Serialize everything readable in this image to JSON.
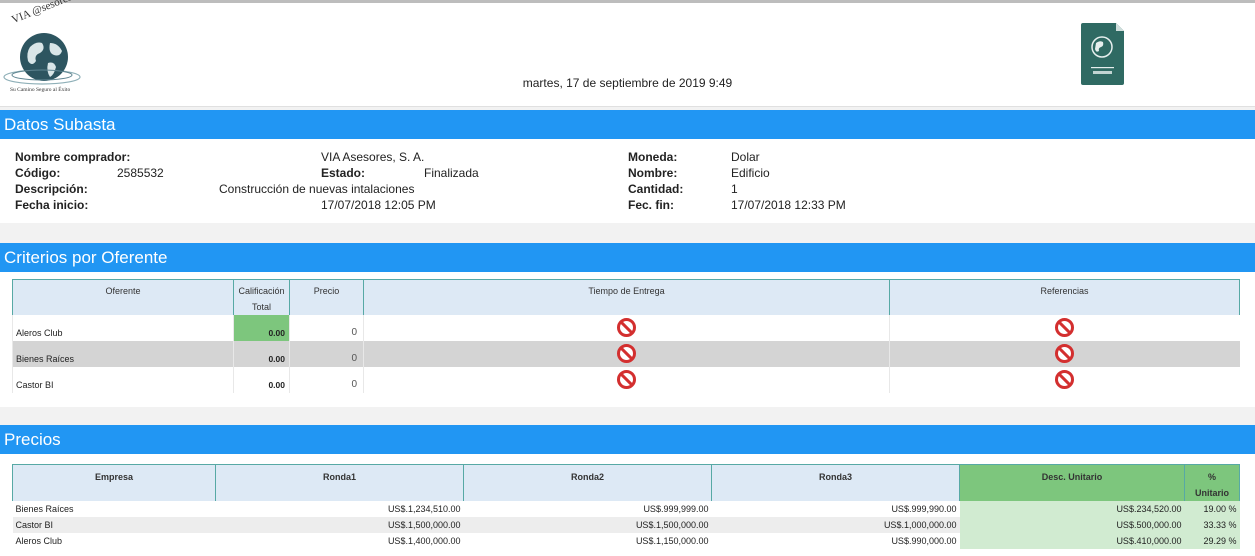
{
  "header": {
    "logo_brand": "VIA @sesores S.A.",
    "logo_slogan": "Su Camino Seguro al Éxito",
    "datetime": "martes, 17 de septiembre de 2019 9:49"
  },
  "sections": {
    "datos": "Datos Subasta",
    "criterios": "Criterios por Oferente",
    "precios": "Precios"
  },
  "datos": {
    "nombre_comprador_label": "Nombre comprador:",
    "nombre_comprador": "VIA Asesores, S. A.",
    "codigo_label": "Código:",
    "codigo": "2585532",
    "estado_label": "Estado:",
    "estado": "Finalizada",
    "descripcion_label": "Descripción:",
    "descripcion": "Construcción de nuevas intalaciones",
    "fecha_inicio_label": "Fecha inicio:",
    "fecha_inicio": "17/07/2018 12:05 PM",
    "moneda_label": "Moneda:",
    "moneda": "Dolar",
    "nombre_label": "Nombre:",
    "nombre": "Edificio",
    "cantidad_label": "Cantidad:",
    "cantidad": "1",
    "fec_fin_label": "Fec. fin:",
    "fec_fin": "17/07/2018 12:33 PM"
  },
  "criterios": {
    "headers": {
      "oferente": "Oferente",
      "calificacion": "Calificación",
      "total": "Total",
      "precio": "Precio",
      "tiempo": "Tiempo de Entrega",
      "referencias": "Referencias"
    },
    "rows": [
      {
        "oferente": "Aleros Club",
        "calificacion": "0.00",
        "precio": "0"
      },
      {
        "oferente": "Bienes Raíces",
        "calificacion": "0.00",
        "precio": "0"
      },
      {
        "oferente": "Castor BI",
        "calificacion": "0.00",
        "precio": "0"
      }
    ],
    "icon": "no-entry-icon",
    "highlight_color": "#7dc67d"
  },
  "precios": {
    "headers": {
      "empresa": "Empresa",
      "ronda1": "Ronda1",
      "ronda2": "Ronda2",
      "ronda3": "Ronda3",
      "desc": "Desc. Unitario",
      "pct1": "%",
      "pct2": "Unitario"
    },
    "rows": [
      {
        "empresa": "Bienes Raíces",
        "ronda1": "US$.1,234,510.00",
        "ronda2": "US$.999,999.00",
        "ronda3": "US$.999,990.00",
        "desc": "US$.234,520.00",
        "pct": "19.00 %"
      },
      {
        "empresa": "Castor BI",
        "ronda1": "US$.1,500,000.00",
        "ronda2": "US$.1,500,000.00",
        "ronda3": "US$.1,000,000.00",
        "desc": "US$.500,000.00",
        "pct": "33.33 %"
      },
      {
        "empresa": "Aleros Club",
        "ronda1": "US$.1,400,000.00",
        "ronda2": "US$.1,150,000.00",
        "ronda3": "US$.990,000.00",
        "desc": "US$.410,000.00",
        "pct": "29.29 %"
      }
    ]
  },
  "colors": {
    "section_bar": "#2196f3",
    "header_bg": "#dde9f5",
    "green": "#7dc67d",
    "light_green": "#d1ebd1",
    "no_entry_red": "#d32f2f"
  }
}
